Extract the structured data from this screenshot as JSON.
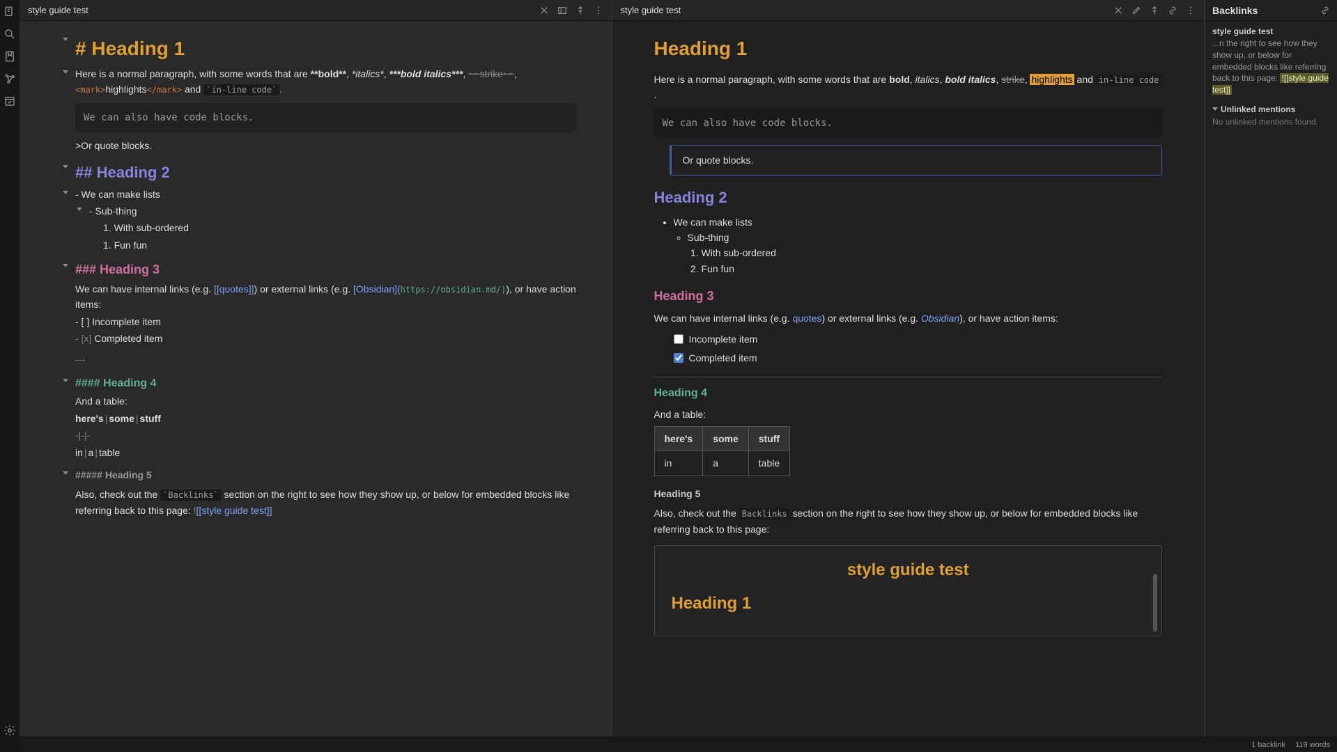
{
  "leftTab": {
    "title": "style guide test"
  },
  "rightTab": {
    "title": "style guide test"
  },
  "source": {
    "h1": "# Heading 1",
    "para1_pre": "Here is a normal paragraph, with some words that are ",
    "bold": "**bold**",
    "c1": ", ",
    "ital": "*italics*",
    "c2": ", ",
    "boldital": "***bold italics***",
    "c3": ", ",
    "strike": "~~strike~~",
    "c4": ", ",
    "mark_open": "<mark>",
    "mark_text": "highlights",
    "mark_close": "</mark>",
    "and": " and ",
    "code_tick": "`in-line code`",
    "dot": ".",
    "code_block": "We can also have code blocks.",
    "quote_src": ">Or quote blocks.",
    "h2": "## Heading 2",
    "li1": "- We can make lists",
    "li2": "- Sub-thing",
    "li3": "1. With sub-ordered",
    "li4": "1. Fun fun",
    "h3": "### Heading 3",
    "p3_a": "We can have internal links (e.g. ",
    "p3_quotes": "[[quotes]]",
    "p3_b": ") or external links (e.g. ",
    "p3_obs": "[Obsidian](",
    "p3_url": "https://obsidian.md/)",
    "p3_c": "), or have action items:",
    "task1": "- [ ] Incomplete item",
    "task2_mark": "- [x]",
    "task2_text": " Completed item",
    "hr": "---",
    "h4": "#### Heading 4",
    "p4": "And a table:",
    "th": "here's | some | stuff",
    "th1": "here's",
    "th2": "some",
    "th3": "stuff",
    "tsep": "-|-|-",
    "tr": "in | a | table",
    "tr1": "in",
    "tr2": "a",
    "tr3": "table",
    "h5": "##### Heading 5",
    "p5_a": "Also, check out the ",
    "p5_code": "`Backlinks`",
    "p5_b": " section on the right to see how they show up, or below for embedded blocks like referring back to this page: ",
    "p5_bang": "!",
    "p5_ref": "[[style guide test]]"
  },
  "preview": {
    "h1": "Heading 1",
    "p1_a": "Here is a normal paragraph, with some words that are ",
    "bold": "bold",
    "ital": "italics",
    "boldital": "bold italics",
    "strike": "strike",
    "highlights": "highlights",
    "and": " and ",
    "code": "in-line code",
    "codeblock": "We can also have code blocks.",
    "quote": "Or quote blocks.",
    "h2": "Heading 2",
    "li1": "We can make lists",
    "li2": "Sub-thing",
    "li3": "With sub-ordered",
    "li4": "Fun fun",
    "h3": "Heading 3",
    "p3_a": "We can have internal links (e.g. ",
    "p3_quotes": "quotes",
    "p3_b": ") or external links (e.g. ",
    "p3_obs": "Obsidian",
    "p3_c": "), or have action items:",
    "task1": "Incomplete item",
    "task2": "Completed item",
    "h4": "Heading 4",
    "p4": "And a table:",
    "th1": "here's",
    "th2": "some",
    "th3": "stuff",
    "td1": "in",
    "td2": "a",
    "td3": "table",
    "h5": "Heading 5",
    "p5_a": "Also, check out the ",
    "p5_code": "Backlinks",
    "p5_b": " section on the right to see how they show up, or below for embedded blocks like referring back to this page:",
    "embed_title": "style guide test",
    "embed_h1": "Heading 1"
  },
  "backlinks": {
    "title": "Backlinks",
    "note": "style guide test",
    "excerpt": "...n the right to see how they show up, or below for embedded blocks like referring back to this page: ",
    "ref": "![[style guide test]]",
    "unlinked": "Unlinked mentions",
    "none": "No unlinked mentions found."
  },
  "status": {
    "backlinks": "1 backlink",
    "words": "119 words"
  }
}
